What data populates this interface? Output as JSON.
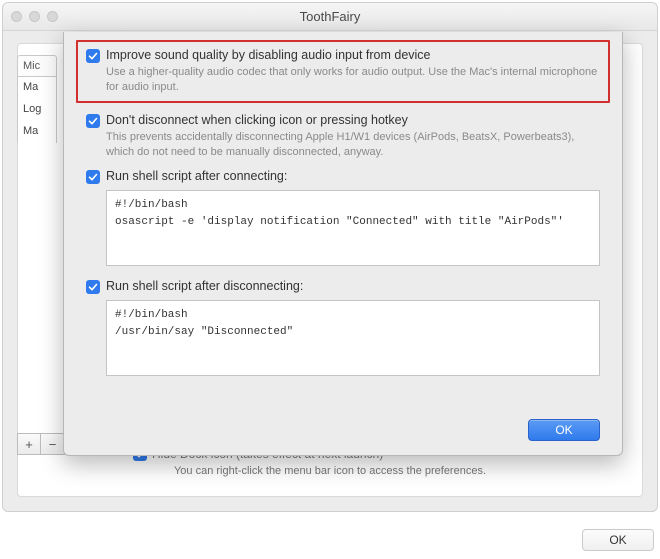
{
  "window": {
    "title": "ToothFairy"
  },
  "sidebar": {
    "header": "Mic",
    "rows": [
      "Ma",
      "Log",
      "Ma"
    ]
  },
  "addremove": {
    "plus": "+",
    "minus": "−"
  },
  "hidedock": {
    "label": "Hide Dock icon (takes effect at next launch)"
  },
  "hint": "You can right-click the menu bar icon to access the preferences.",
  "sheet": {
    "opt1": {
      "label": "Improve sound quality by disabling audio input from device",
      "desc": "Use a higher-quality audio codec that only works for audio output. Use the Mac's internal microphone for audio input."
    },
    "opt2": {
      "label": "Don't disconnect when clicking icon or pressing hotkey",
      "desc": "This prevents accidentally disconnecting Apple H1/W1 devices (AirPods, BeatsX, Powerbeats3), which do not need to be manually disconnected, anyway."
    },
    "opt3": {
      "label": "Run shell script after connecting:",
      "script": "#!/bin/bash\nosascript -e 'display notification \"Connected\" with title \"AirPods\"'"
    },
    "opt4": {
      "label": "Run shell script after disconnecting:",
      "script": "#!/bin/bash\n/usr/bin/say \"Disconnected\""
    },
    "ok": "OK"
  },
  "mainok": "OK"
}
